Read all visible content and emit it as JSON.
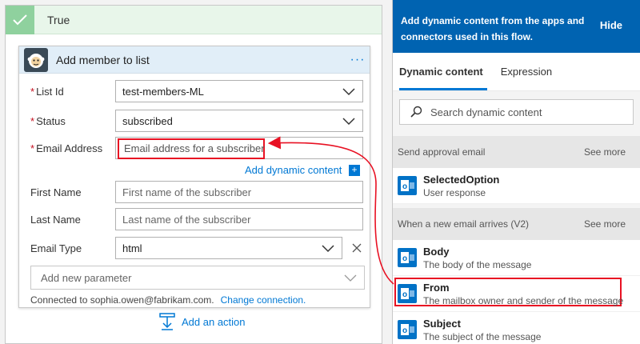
{
  "branch": {
    "title": "True"
  },
  "card": {
    "title": "Add member to list",
    "more_label": "···",
    "fields": {
      "list_id": {
        "label": "List Id",
        "value": "test-members-ML"
      },
      "status": {
        "label": "Status",
        "value": "subscribed"
      },
      "email": {
        "label": "Email Address",
        "placeholder": "Email address for a subscriber"
      },
      "first_name": {
        "label": "First Name",
        "placeholder": "First name of the subscriber"
      },
      "last_name": {
        "label": "Last Name",
        "placeholder": "Last name of the subscriber"
      },
      "email_type": {
        "label": "Email Type",
        "value": "html"
      }
    },
    "required_marker": "*",
    "add_dynamic_content": "Add dynamic content",
    "add_param": "Add new parameter",
    "connected_to": "Connected to sophia.owen@fabrikam.com.",
    "change_connection": "Change connection."
  },
  "add_action": "Add an action",
  "panel": {
    "header": "Add dynamic content from the apps and connectors used in this flow.",
    "hide": "Hide",
    "tabs": [
      {
        "label": "Dynamic content"
      },
      {
        "label": "Expression"
      }
    ],
    "search_placeholder": "Search dynamic content",
    "sections": [
      {
        "title": "Send approval email",
        "see_more": "See more",
        "items": [
          {
            "title": "SelectedOption",
            "desc": "User response"
          }
        ]
      },
      {
        "title": "When a new email arrives (V2)",
        "see_more": "See more",
        "items": [
          {
            "title": "Body",
            "desc": "The body of the message"
          },
          {
            "title": "From",
            "desc": "The mailbox owner and sender of the message"
          },
          {
            "title": "Subject",
            "desc": "The subject of the message"
          }
        ]
      }
    ]
  },
  "colors": {
    "accent": "#0078d4",
    "panel_header": "#0063b1",
    "highlight": "#e81123",
    "branch_green": "#8fd19e",
    "outlook_blue": "#0072c6"
  }
}
